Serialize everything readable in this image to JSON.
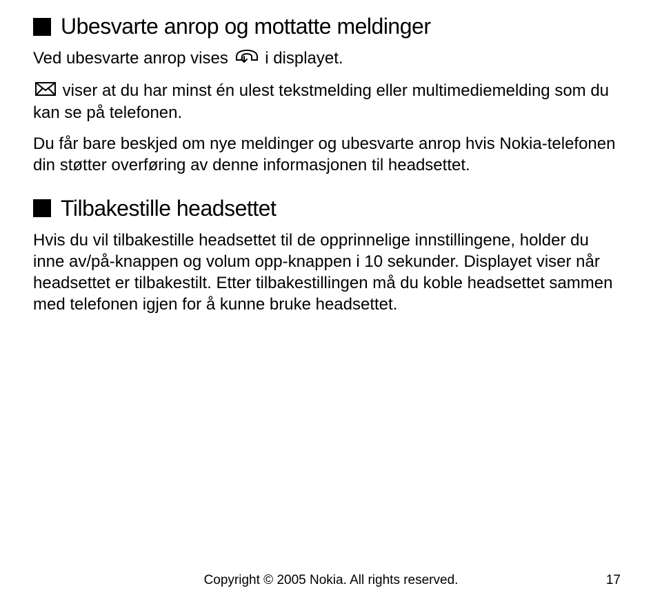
{
  "section1": {
    "heading": "Ubesvarte anrop og mottatte meldinger",
    "p1a": "Ved ubesvarte anrop vises ",
    "p1b": " i displayet.",
    "p2a": " viser at du har minst én ulest tekstmelding eller multimediemelding som du kan se på telefonen.",
    "p3": "Du får bare beskjed om nye meldinger og ubesvarte anrop hvis Nokia-telefonen din støtter overføring av denne informasjonen til headsettet."
  },
  "section2": {
    "heading": "Tilbakestille headsettet",
    "p1": "Hvis du vil tilbakestille headsettet til de opprinnelige innstillingene, holder du inne av/på-knappen og volum opp-knappen i 10 sekunder. Displayet viser når headsettet er tilbakestilt. Etter tilbakestillingen må du koble headsettet sammen med telefonen igjen for å kunne bruke headsettet."
  },
  "footer": {
    "copyright": "Copyright © 2005 Nokia. All rights reserved.",
    "page": "17"
  }
}
